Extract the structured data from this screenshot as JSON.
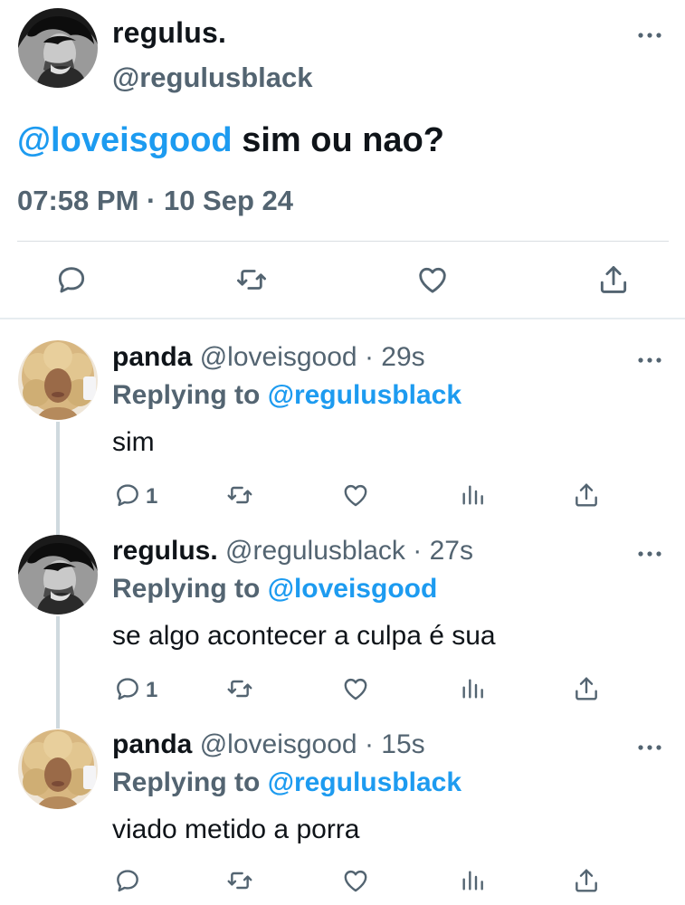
{
  "main_tweet": {
    "display_name": "regulus.",
    "handle": "@regulusblack",
    "mention": "@loveisgood",
    "text": "sim ou nao?",
    "timestamp": "07:58 PM · 10 Sep 24"
  },
  "replies": [
    {
      "display_name": "panda",
      "handle": "@loveisgood",
      "time": "· 29s",
      "replying_prefix": "Replying to",
      "replying_to": "@regulusblack",
      "text": "sim",
      "reply_count": "1"
    },
    {
      "display_name": "regulus.",
      "handle": "@regulusblack",
      "time": "· 27s",
      "replying_prefix": "Replying to",
      "replying_to": "@loveisgood",
      "text": "se algo acontecer a culpa é sua",
      "reply_count": "1"
    },
    {
      "display_name": "panda",
      "handle": "@loveisgood",
      "time": "· 15s",
      "replying_prefix": "Replying to",
      "replying_to": "@regulusblack",
      "text": "viado metido a porra",
      "reply_count": ""
    }
  ],
  "icons": {
    "more": "more-horizontal-icon",
    "reply": "reply-bubble-icon",
    "retweet": "retweet-icon",
    "like": "heart-icon",
    "views": "views-bars-icon",
    "share": "share-icon"
  },
  "colors": {
    "text": "#0f1419",
    "secondary": "#536471",
    "accent": "#1d9bf0",
    "divider": "#d9dee2"
  }
}
